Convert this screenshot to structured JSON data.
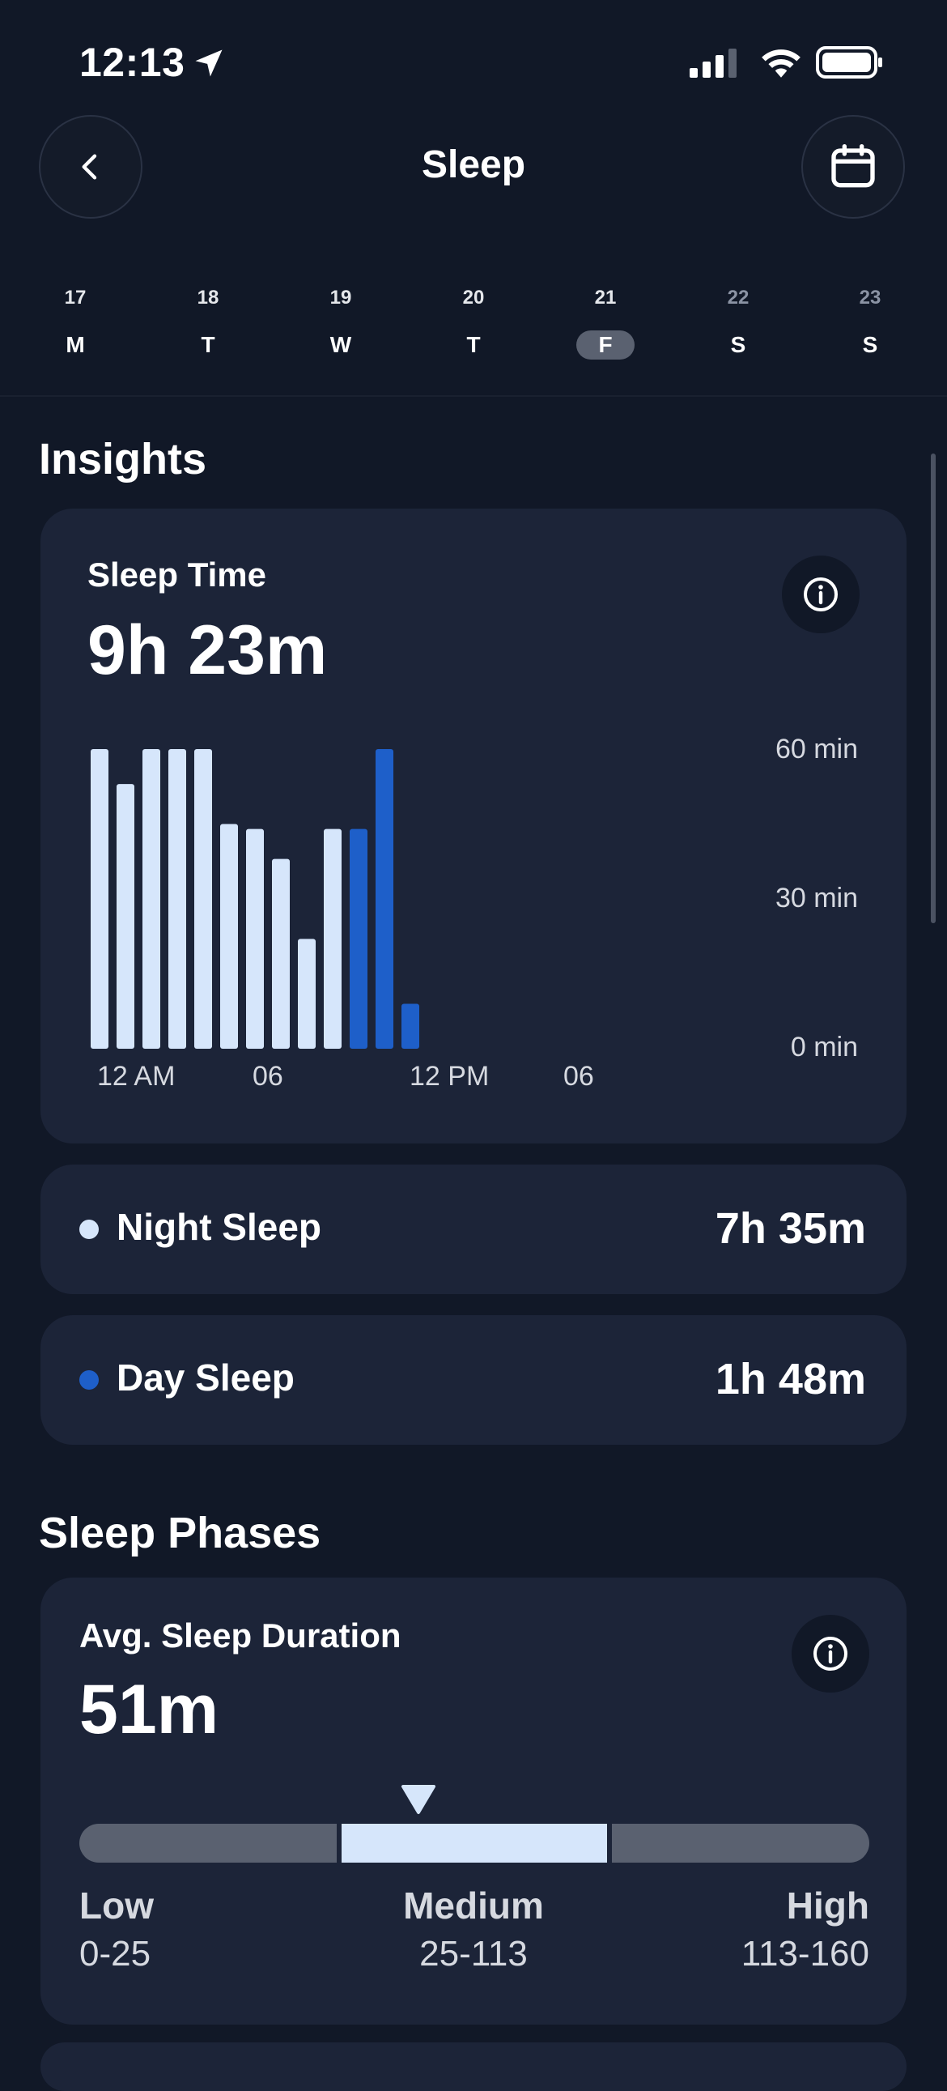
{
  "status_bar": {
    "time": "12:13"
  },
  "header": {
    "title": "Sleep"
  },
  "week": [
    {
      "num": "17",
      "letter": "M",
      "state": "past"
    },
    {
      "num": "18",
      "letter": "T",
      "state": "past"
    },
    {
      "num": "19",
      "letter": "W",
      "state": "past"
    },
    {
      "num": "20",
      "letter": "T",
      "state": "past"
    },
    {
      "num": "21",
      "letter": "F",
      "state": "selected"
    },
    {
      "num": "22",
      "letter": "S",
      "state": "future"
    },
    {
      "num": "23",
      "letter": "S",
      "state": "future"
    }
  ],
  "insights": {
    "section_title": "Insights",
    "sleep_time_label": "Sleep Time",
    "sleep_time_value": "9h 23m"
  },
  "chart_data": {
    "type": "bar",
    "title": "Sleep Time",
    "y_ticks": [
      "60 min",
      "30 min",
      "0 min"
    ],
    "x_ticks": [
      "12 AM",
      "06",
      "12 PM",
      "06"
    ],
    "ylim": [
      0,
      60
    ],
    "series": [
      {
        "name": "Night Sleep",
        "color": "#d6e6fb",
        "values": [
          60,
          53,
          60,
          60,
          60,
          45,
          44,
          38,
          22,
          44,
          0,
          0,
          0
        ]
      },
      {
        "name": "Day Sleep",
        "color": "#1e5fc9",
        "values": [
          0,
          0,
          0,
          0,
          0,
          0,
          0,
          0,
          0,
          0,
          44,
          60,
          9
        ]
      }
    ]
  },
  "night_sleep": {
    "label": "Night Sleep",
    "value": "7h 35m",
    "color": "#d6e6fb"
  },
  "day_sleep": {
    "label": "Day Sleep",
    "value": "1h 48m",
    "color": "#1e5fc9"
  },
  "phases": {
    "section_title": "Sleep Phases",
    "avg_label": "Avg. Sleep Duration",
    "avg_value": "51m",
    "scale": {
      "low_title": "Low",
      "low_range": "0-25",
      "medium_title": "Medium",
      "medium_range": "25-113",
      "high_title": "High",
      "high_range": "113-160"
    }
  }
}
